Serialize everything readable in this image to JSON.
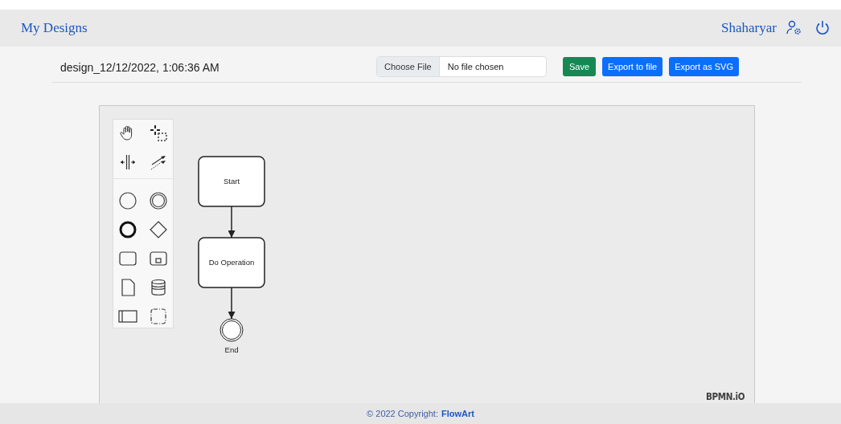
{
  "navbar": {
    "brand": "My Designs",
    "user_name": "Shaharyar"
  },
  "toolbar": {
    "design_name": "design_12/12/2022, 1:06:36 AM",
    "file_input": {
      "button_label": "Choose File",
      "value": "No file chosen"
    },
    "buttons": [
      {
        "label": "Save",
        "kind": "success"
      },
      {
        "label": "Export to file",
        "kind": "primary"
      },
      {
        "label": "Export as SVG",
        "kind": "primary"
      }
    ]
  },
  "diagram": {
    "nodes": [
      {
        "kind": "task",
        "label": "Start"
      },
      {
        "kind": "task",
        "label": "Do Operation"
      },
      {
        "kind": "end",
        "label": "End"
      }
    ],
    "logo": "BPMN.iO"
  },
  "footer": {
    "text": "© 2022 Copyright:",
    "link": "FlowArt"
  }
}
